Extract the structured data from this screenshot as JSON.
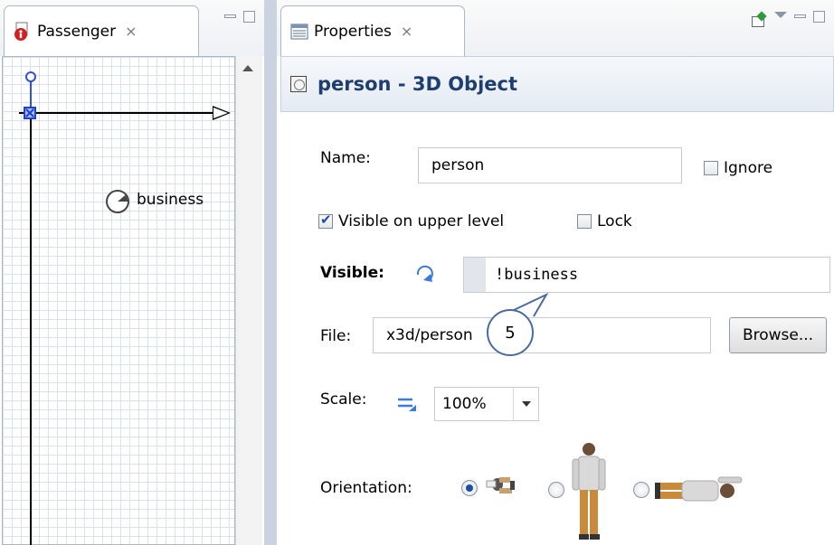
{
  "passenger_view": {
    "tab_title": "Passenger",
    "canvas": {
      "element_label": "business"
    }
  },
  "properties_view": {
    "tab_title": "Properties",
    "header_title": "person - 3D Object",
    "name_label": "Name:",
    "name_value": "person",
    "ignore_label": "Ignore",
    "ignore_checked": false,
    "visible_upper_label": "Visible on upper level",
    "visible_upper_checked": true,
    "lock_label": "Lock",
    "lock_checked": false,
    "visible_label": "Visible:",
    "visible_value": "!business",
    "file_label": "File:",
    "file_value": "x3d/person",
    "browse_label": "Browse...",
    "scale_label": "Scale:",
    "scale_value": "100%",
    "orientation_label": "Orientation:",
    "orientation_selected": 0
  },
  "callout": {
    "number": "5"
  }
}
